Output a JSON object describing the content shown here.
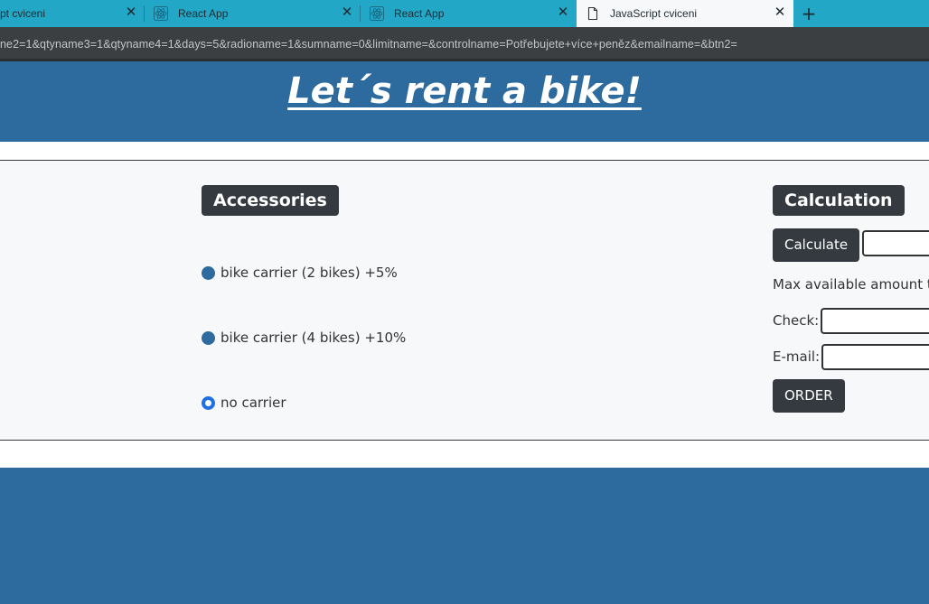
{
  "browser": {
    "tabs": [
      {
        "title": "pt cviceni",
        "active": false
      },
      {
        "title": "React App",
        "active": false
      },
      {
        "title": "React App",
        "active": false
      },
      {
        "title": "JavaScript cviceni",
        "active": true
      }
    ],
    "new_tab_symbol": "+",
    "close_symbol": "✕",
    "url": "ne2=1&qtyname3=1&qtyname4=1&days=5&radioname=1&sumname=0&limitname=&controlname=Potřebujete+více+peněz&emailname=&btn2="
  },
  "header": {
    "title": "Let´s rent a bike!"
  },
  "accessories": {
    "heading": "Accessories",
    "options": [
      {
        "label": "bike carrier (2 bikes) +5%",
        "checked": false
      },
      {
        "label": "bike carrier (4 bikes) +10%",
        "checked": false
      },
      {
        "label": "no carrier",
        "checked": true
      }
    ]
  },
  "calculation": {
    "heading": "Calculation",
    "calculate_button": "Calculate",
    "max_amount_label": "Max available amount to",
    "check_label": "Check:",
    "email_label": "E-mail:",
    "order_button": "ORDER"
  },
  "colors": {
    "primary_blue": "#2d6a9e",
    "tab_strip": "#23a7c6",
    "dark_badge": "#343a40",
    "radio_checked": "#1f6fe6"
  }
}
